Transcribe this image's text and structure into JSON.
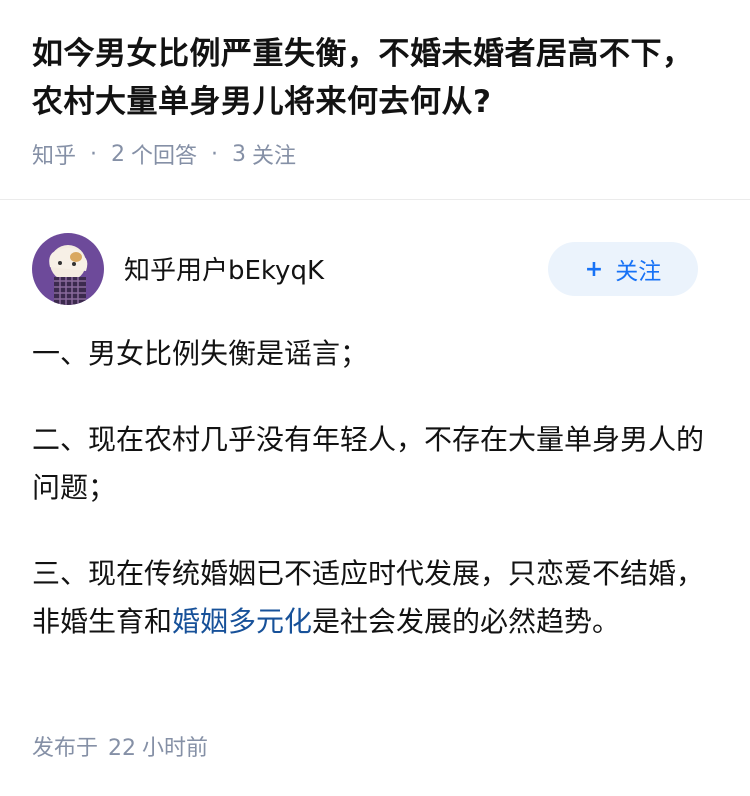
{
  "question": {
    "title": "如今男女比例严重失衡，不婚未婚者居高不下，农村大量单身男儿将来何去何从?",
    "source": "知乎",
    "answer_count": "2",
    "answer_label": "个回答",
    "follow_count": "3",
    "follow_label": "关注"
  },
  "author": {
    "name": "知乎用户bEkyqK",
    "follow_button_label": "关注",
    "follow_icon": "plus-icon"
  },
  "answer": {
    "paragraph_1": "一、男女比例失衡是谣言；",
    "paragraph_2": "二、现在农村几乎没有年轻人，不存在大量单身男人的问题；",
    "paragraph_3_before_link": "三、现在传统婚姻已不适应时代发展，只恋爱不结婚，非婚生育和",
    "paragraph_3_link": "婚姻多元化",
    "paragraph_3_after_link": "是社会发展的必然趋势。"
  },
  "publish": {
    "prefix": "发布于",
    "amount": "22",
    "unit": "小时前"
  },
  "colors": {
    "meta_gray": "#8590a6",
    "link_blue": "#175199",
    "button_blue": "#1772f6",
    "button_bg": "#ebf3fc",
    "avatar_bg": "#6d4a9a"
  }
}
